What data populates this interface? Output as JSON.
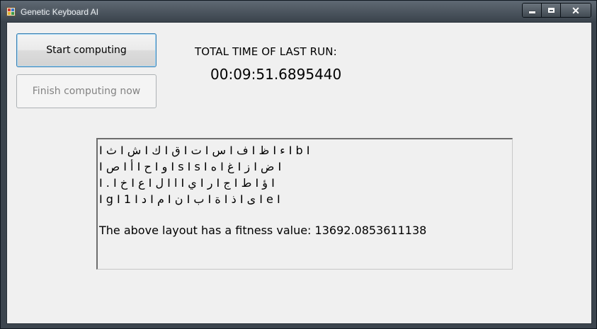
{
  "window": {
    "title": "Genetic Keyboard AI",
    "icon": "app-icon",
    "controls": {
      "minimize": "minimize-icon",
      "maximize": "maximize-icon",
      "close": "close-icon"
    }
  },
  "buttons": {
    "start_label": "Start computing",
    "finish_label": "Finish computing now"
  },
  "timing": {
    "label": "TOTAL TIME OF LAST RUN:",
    "value": "00:09:51.6895440"
  },
  "output": {
    "layout_lines": [
      "I ث I ش I ك I ق I ت I س I ف I ظ I ء I b I",
      "I ص I أ I ح I و I s I s I ه I غ I ز I ض I",
      "I . I خ I ع I ل I ا I ي I ر I ج I ط I ؤ I",
      "I g I 1 I د I م I ن I ب I ة I ذ I ى I e I"
    ],
    "fitness_text": "The above layout has a fitness value: 13692.0853611138"
  },
  "colors": {
    "window_frame": "#454d56",
    "client_bg": "#f0f0f0",
    "start_border": "#3c7fb1",
    "disabled_text": "#838383"
  }
}
